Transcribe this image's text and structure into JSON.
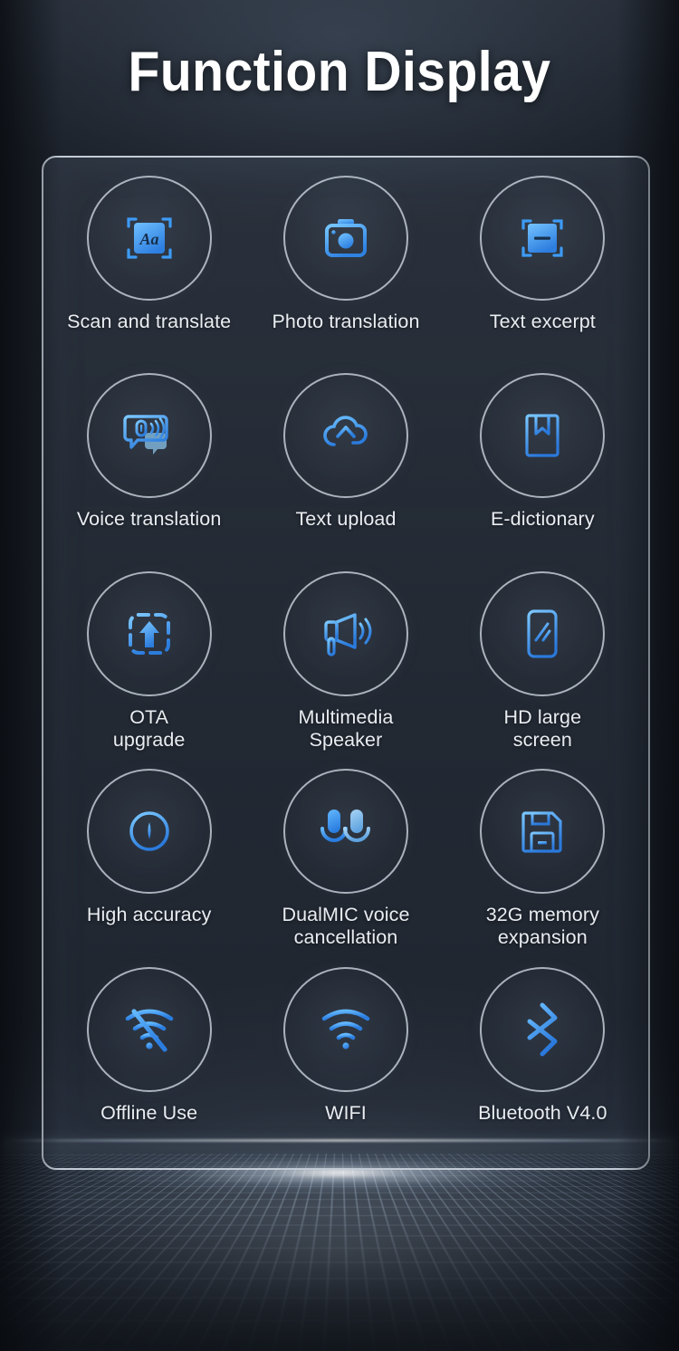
{
  "page": {
    "title": "Function Display",
    "background_color": "#1a1f28",
    "accent_color": "#3d9bf5",
    "panel_border_color": "#c3ccd6",
    "label_color": "#e9edf2"
  },
  "features": [
    {
      "id": "scan-and-translate",
      "icon": "scan-text-aa-icon",
      "label_line1": "Scan and translate",
      "label_line2": ""
    },
    {
      "id": "photo-translation",
      "icon": "camera-icon",
      "label_line1": "Photo translation",
      "label_line2": ""
    },
    {
      "id": "text-excerpt",
      "icon": "text-excerpt-frame-icon",
      "label_line1": "Text excerpt",
      "label_line2": ""
    },
    {
      "id": "voice-translation",
      "icon": "speech-bubbles-mic-icon",
      "label_line1": "Voice translation",
      "label_line2": ""
    },
    {
      "id": "text-upload",
      "icon": "cloud-upload-icon",
      "label_line1": "Text upload",
      "label_line2": ""
    },
    {
      "id": "e-dictionary",
      "icon": "book-bookmark-icon",
      "label_line1": "E-dictionary",
      "label_line2": ""
    },
    {
      "id": "ota-upgrade",
      "icon": "dashed-box-up-arrow-icon",
      "label_line1": "OTA",
      "label_line2": "upgrade"
    },
    {
      "id": "multimedia-speaker",
      "icon": "megaphone-icon",
      "label_line1": "Multimedia",
      "label_line2": "Speaker"
    },
    {
      "id": "hd-large-screen",
      "icon": "phone-screen-shine-icon",
      "label_line1": "HD large",
      "label_line2": "screen"
    },
    {
      "id": "high-accuracy",
      "icon": "crosshair-target-icon",
      "label_line1": "High accuracy",
      "label_line2": ""
    },
    {
      "id": "dualmic-voice-cancellation",
      "icon": "dual-microphone-icon",
      "label_line1": "DualMIC voice",
      "label_line2": "cancellation"
    },
    {
      "id": "32g-memory-expansion",
      "icon": "memory-card-icon",
      "label_line1": "32G memory",
      "label_line2": "expansion"
    },
    {
      "id": "offline-use",
      "icon": "wifi-off-icon",
      "label_line1": "Offline Use",
      "label_line2": ""
    },
    {
      "id": "wifi",
      "icon": "wifi-icon",
      "label_line1": "WIFI",
      "label_line2": ""
    },
    {
      "id": "bluetooth",
      "icon": "bluetooth-icon",
      "label_line1": "Bluetooth V4.0",
      "label_line2": ""
    }
  ]
}
